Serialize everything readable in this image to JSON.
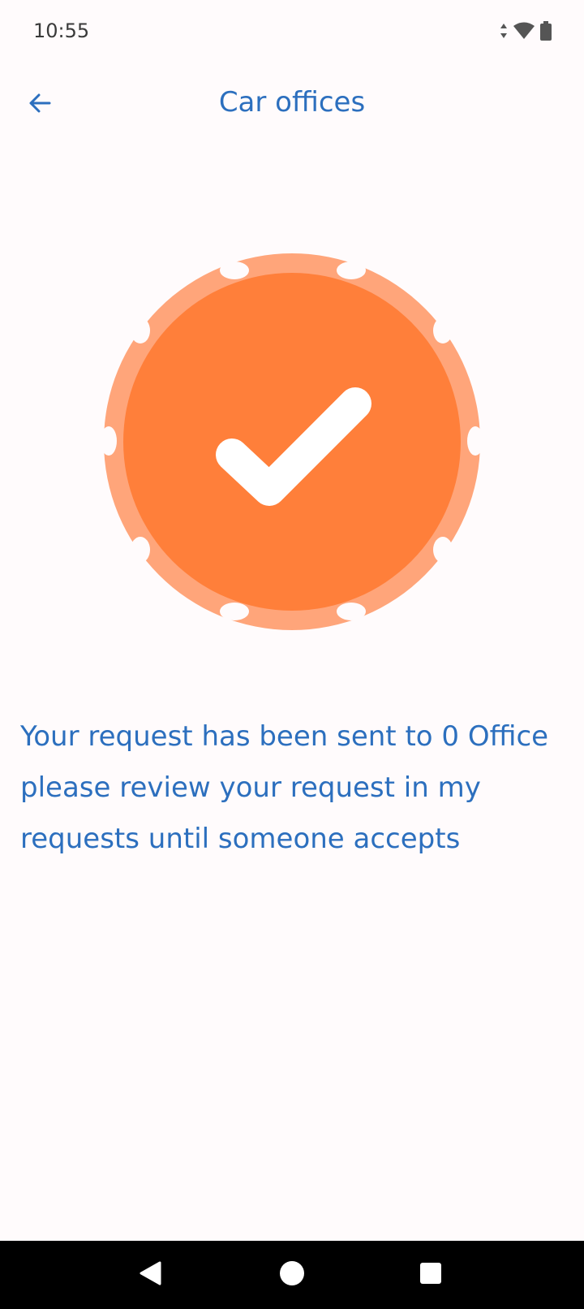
{
  "status_bar": {
    "time": "10:55",
    "icons": [
      "data-arrows-icon",
      "wifi-icon",
      "battery-icon"
    ]
  },
  "app_bar": {
    "title": "Car offices",
    "back_icon": "arrow-back-icon"
  },
  "success": {
    "icon": "checkmark-badge-icon",
    "badge_color": "#FF7F3A",
    "badge_edge_color": "#FFA57A",
    "message": "Your request has been sent to 0 Office please review your request in my requests until someone accepts"
  },
  "nav_bar": {
    "icons": [
      "back-triangle-icon",
      "home-circle-icon",
      "recents-square-icon"
    ]
  },
  "colors": {
    "primary_text": "#2C6FBE",
    "background": "#FFFBFC"
  }
}
